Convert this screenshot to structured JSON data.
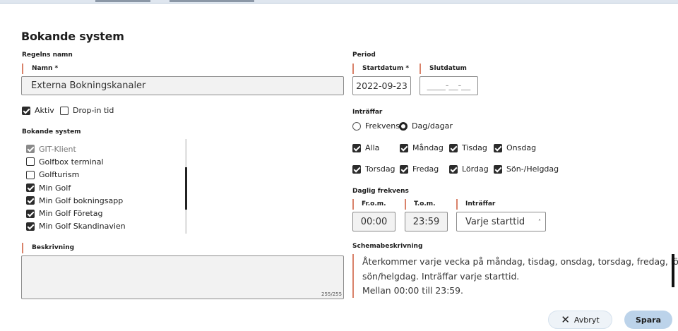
{
  "title": "Bokande system",
  "rule_name": {
    "section_label": "Regelns namn",
    "field_label": "Namn *",
    "value": "Externa Bokningskanaler"
  },
  "flags": [
    {
      "label": "Aktiv",
      "checked": true
    },
    {
      "label": "Drop-in tid",
      "checked": false
    }
  ],
  "booking_systems": {
    "label": "Bokande system",
    "items": [
      {
        "label": "GIT-Klient",
        "checked": true,
        "disabled": true
      },
      {
        "label": "Golfbox terminal",
        "checked": false
      },
      {
        "label": "Golfturism",
        "checked": false
      },
      {
        "label": "Min Golf",
        "checked": true
      },
      {
        "label": "Min Golf bokningsapp",
        "checked": true
      },
      {
        "label": "Min Golf Företag",
        "checked": true
      },
      {
        "label": "Min Golf Skandinavien",
        "checked": true
      }
    ]
  },
  "description": {
    "label": "Beskrivning",
    "value": "",
    "counter": "255/255"
  },
  "period": {
    "label": "Period",
    "start_label": "Startdatum *",
    "start_value": "2022-09-23",
    "end_label": "Slutdatum",
    "end_placeholder": "____-__-__"
  },
  "occurs": {
    "label": "Inträffar",
    "options": [
      {
        "label": "Frekvens",
        "selected": false
      },
      {
        "label": "Dag/dagar",
        "selected": true
      }
    ],
    "days_row1": [
      {
        "label": "Alla",
        "checked": true
      },
      {
        "label": "Måndag",
        "checked": true
      },
      {
        "label": "Tisdag",
        "checked": true
      },
      {
        "label": "Onsdag",
        "checked": true
      }
    ],
    "days_row2": [
      {
        "label": "Torsdag",
        "checked": true
      },
      {
        "label": "Fredag",
        "checked": true
      },
      {
        "label": "Lördag",
        "checked": true
      },
      {
        "label": "Sön-/Helgdag",
        "checked": true
      }
    ]
  },
  "daily_freq": {
    "label": "Daglig frekvens",
    "from_label": "Fr.o.m.",
    "from_value": "00:00",
    "to_label": "T.o.m.",
    "to_value": "23:59",
    "occurs_label": "Inträffar",
    "occurs_value": "Varje starttid"
  },
  "schedule": {
    "label": "Schemabeskrivning",
    "line1": "Återkommer varje vecka på måndag, tisdag, onsdag, torsdag, fredag, lördag,",
    "line2": "sön/helgdag. Inträffar varje starttid.",
    "line3": "Mellan 00:00 till 23:59."
  },
  "buttons": {
    "cancel": "Avbryt",
    "save": "Spara"
  },
  "colors": {
    "accent": "#d9826a",
    "save_bg": "#bcd3ea",
    "cancel_bg": "#eef3f8"
  }
}
